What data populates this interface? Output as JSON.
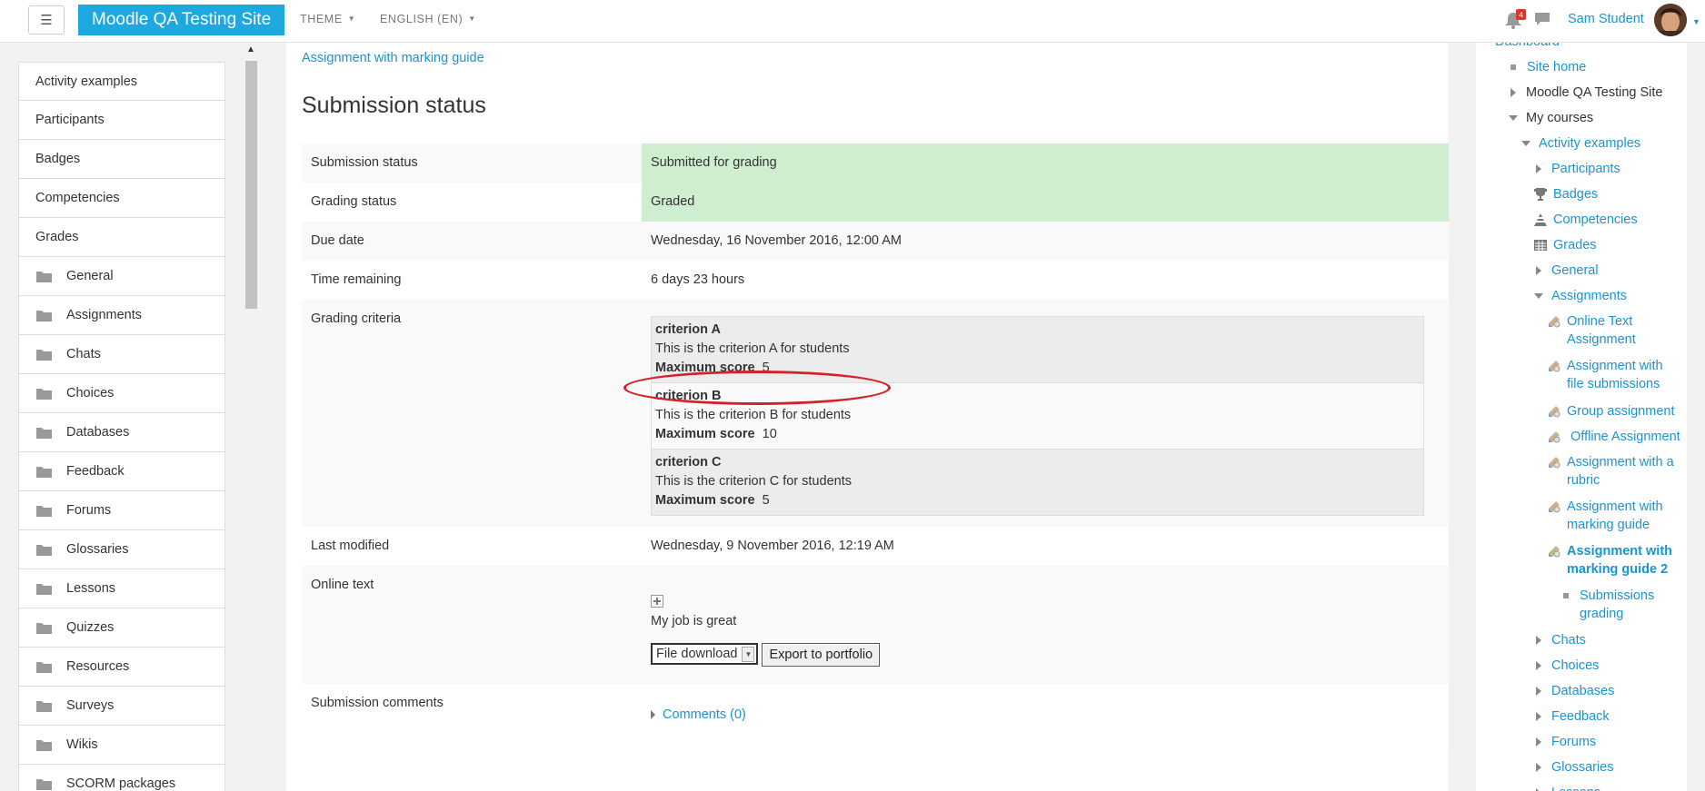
{
  "navbar": {
    "menu_toggle": "☰",
    "brand": "Moodle QA Testing Site",
    "theme_menu": "THEME",
    "language_menu": "ENGLISH (EN)",
    "notification_count": "4",
    "user_name": "Sam Student"
  },
  "drawer": {
    "items": [
      {
        "label": "Activity examples",
        "icon": ""
      },
      {
        "label": "Participants",
        "icon": ""
      },
      {
        "label": "Badges",
        "icon": ""
      },
      {
        "label": "Competencies",
        "icon": ""
      },
      {
        "label": "Grades",
        "icon": ""
      },
      {
        "label": "General",
        "icon": "folder-icon"
      },
      {
        "label": "Assignments",
        "icon": "folder-icon"
      },
      {
        "label": "Chats",
        "icon": "folder-icon"
      },
      {
        "label": "Choices",
        "icon": "folder-icon"
      },
      {
        "label": "Databases",
        "icon": "folder-icon"
      },
      {
        "label": "Feedback",
        "icon": "folder-icon"
      },
      {
        "label": "Forums",
        "icon": "folder-icon"
      },
      {
        "label": "Glossaries",
        "icon": "folder-icon"
      },
      {
        "label": "Lessons",
        "icon": "folder-icon"
      },
      {
        "label": "Quizzes",
        "icon": "folder-icon"
      },
      {
        "label": "Resources",
        "icon": "folder-icon"
      },
      {
        "label": "Surveys",
        "icon": "folder-icon"
      },
      {
        "label": "Wikis",
        "icon": "folder-icon"
      },
      {
        "label": "SCORM packages",
        "icon": "folder-icon"
      }
    ]
  },
  "main": {
    "breadcrumb_link": "Assignment with marking guide",
    "title": "Submission status",
    "rows": {
      "submission_status": {
        "label": "Submission status",
        "value": "Submitted for grading"
      },
      "grading_status": {
        "label": "Grading status",
        "value": "Graded"
      },
      "due_date": {
        "label": "Due date",
        "value": "Wednesday, 16 November 2016, 12:00 AM"
      },
      "time_remaining": {
        "label": "Time remaining",
        "value": "6 days 23 hours"
      },
      "grading_criteria": {
        "label": "Grading criteria"
      },
      "last_modified": {
        "label": "Last modified",
        "value": "Wednesday, 9 November 2016, 12:19 AM"
      },
      "online_text": {
        "label": "Online text",
        "value": "My job is great"
      },
      "submission_comments": {
        "label": "Submission comments",
        "value": "Comments (0)"
      }
    },
    "criteria": [
      {
        "name": "criterion A",
        "description": "This is the criterion A for students",
        "max_label": "Maximum score",
        "max_value": "5"
      },
      {
        "name": "criterion B",
        "description": "This is the criterion B for students",
        "max_label": "Maximum score",
        "max_value": "10"
      },
      {
        "name": "criterion C",
        "description": "This is the criterion C for students",
        "max_label": "Maximum score",
        "max_value": "5"
      }
    ],
    "export_select": "File download",
    "export_button": "Export to portfolio",
    "highlight_color": "#d2232a"
  },
  "navigation": {
    "dashboard": "Dashboard",
    "site_home": "Site home",
    "site_name": "Moodle QA Testing Site",
    "my_courses": "My courses",
    "course": "Activity examples",
    "participants": "Participants",
    "badges": "Badges",
    "competencies": "Competencies",
    "grades": "Grades",
    "general": "General",
    "assignments": "Assignments",
    "assignments_list": [
      "Online Text Assignment",
      "Assignment with file submissions",
      "Group assignment",
      " Offline Assignment",
      "Assignment with a rubric",
      "Assignment with marking guide",
      "Assignment with marking guide 2"
    ],
    "submissions_grading": "Submissions grading",
    "chats": "Chats",
    "choices": "Choices",
    "databases": "Databases",
    "feedback": "Feedback",
    "forums": "Forums",
    "glossaries": "Glossaries",
    "lessons": "Lessons"
  },
  "colors": {
    "brand": "#1ea8e0",
    "link": "#1b93d1",
    "status_green": "#cfeed0"
  }
}
